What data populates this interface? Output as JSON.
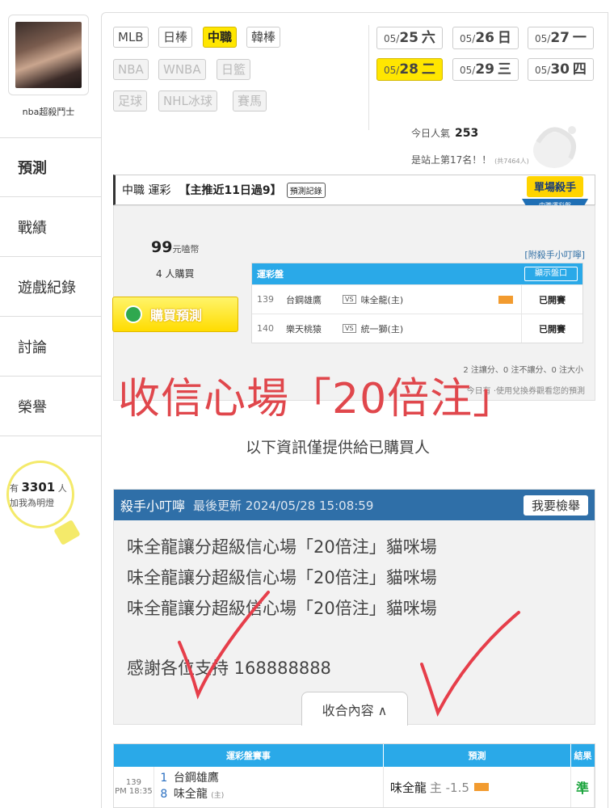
{
  "user": {
    "name": "nba超殺鬥士"
  },
  "side_nav": [
    {
      "label": "預測"
    },
    {
      "label": "戰績"
    },
    {
      "label": "遊戲紀錄"
    },
    {
      "label": "討論"
    },
    {
      "label": "榮譽"
    }
  ],
  "fans": {
    "prefix": "有",
    "count": "3301",
    "unit": "人",
    "sub": "加我為明燈"
  },
  "sports": [
    {
      "label": "MLB",
      "state": "normal"
    },
    {
      "label": "日棒",
      "state": "normal"
    },
    {
      "label": "中職",
      "state": "active"
    },
    {
      "label": "韓棒",
      "state": "normal"
    },
    {
      "label": "NBA",
      "state": "dim"
    },
    {
      "label": "WNBA",
      "state": "dim"
    },
    {
      "label": "日籃",
      "state": "dim"
    },
    {
      "label": "足球",
      "state": "dim"
    },
    {
      "label": "NHL冰球",
      "state": "dim"
    },
    {
      "label": "賽馬",
      "state": "dim"
    }
  ],
  "dates": [
    {
      "md": "05/",
      "day": "25",
      "wd": "六",
      "active": false
    },
    {
      "md": "05/",
      "day": "26",
      "wd": "日",
      "active": false
    },
    {
      "md": "05/",
      "day": "27",
      "wd": "一",
      "active": false
    },
    {
      "md": "05/",
      "day": "28",
      "wd": "二",
      "active": true
    },
    {
      "md": "05/",
      "day": "29",
      "wd": "三",
      "active": false
    },
    {
      "md": "05/",
      "day": "30",
      "wd": "四",
      "active": false
    }
  ],
  "stats": {
    "popularity_label": "今日人氣",
    "popularity_value": "253",
    "rank_text": "是站上第17名！！",
    "rank_small": "(共7464人)"
  },
  "prediction": {
    "league": "中職 運彩",
    "title": "【主推近11日過9】",
    "record_btn": "預測記錄",
    "badge_top": "單場殺手",
    "badge_bottom": "中職運彩盤",
    "price_value": "99",
    "price_unit": "元嗑幣",
    "buyers": "4 人購買",
    "buy_label": "購買預測",
    "tip_link": "[附殺手小叮嚀]",
    "table_title": "運彩盤",
    "show_odds": "顯示盤口",
    "games": [
      {
        "no": "139",
        "away": "台鋼雄鷹",
        "home": "味全龍(主)",
        "status": "已開賽",
        "has_tag": true
      },
      {
        "no": "140",
        "away": "樂天桃猿",
        "home": "統一獅(主)",
        "status": "已開賽",
        "has_tag": false
      }
    ],
    "vs": "VS",
    "summary": "2 注讓分、0 注不讓分、0 注大小",
    "note": "今日有 ·使用兌換券觀看您的預測"
  },
  "overlay_text": "收信心場「20倍注」",
  "info_text": "以下資訊僅提供給已購買人",
  "tips": {
    "title": "殺手小叮嚀",
    "updated": "最後更新 2024/05/28 15:08:59",
    "report_btn": "我要檢舉",
    "lines": [
      "味全龍讓分超級信心場「20倍注」貓咪場",
      "味全龍讓分超級信心場「20倍注」貓咪場",
      "味全龍讓分超級信心場「20倍注」貓咪場"
    ],
    "thanks": "感謝各位支持 168888888",
    "collapse": "收合內容 ∧"
  },
  "results": {
    "head_game": "運彩盤賽事",
    "head_pred": "預測",
    "head_res": "結果",
    "rows": [
      {
        "no": "139",
        "time": "PM 18:35",
        "away_no": "1",
        "away": "台鋼雄鷹",
        "home_no": "8",
        "home": "味全龍",
        "home_mark": "(主)",
        "pick": "味全龍",
        "pick_detail": "主 -1.5",
        "result": "準"
      }
    ]
  },
  "colors": {
    "accent_yellow": "#ffe600",
    "header_blue": "#2aa9e8",
    "tip_blue": "#2f6fa8",
    "overlay_red": "#e0474c",
    "win_green": "#18a33a"
  }
}
